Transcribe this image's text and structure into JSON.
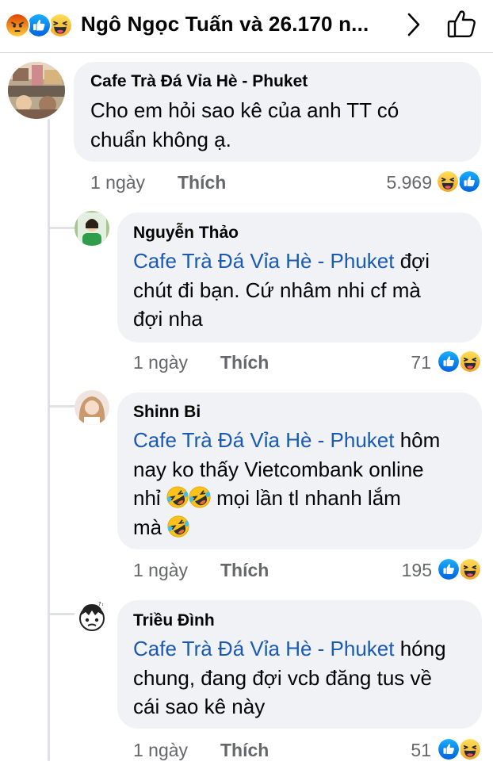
{
  "header": {
    "title": "Ngô Ngọc Tuấn và 26.170 n...",
    "reaction_icons": [
      "angry-icon",
      "like-icon",
      "haha-icon"
    ]
  },
  "comments": [
    {
      "author": "Cafe Trà Đá Vỉa Hè - Phuket",
      "text": "Cho em hỏi sao kê của anh TT có chuẩn không ạ.",
      "time": "1 ngày",
      "like": "Thích",
      "count": "5.969",
      "reactions": [
        "haha-icon",
        "like-icon"
      ]
    }
  ],
  "replies": [
    {
      "author": "Nguyễn Thảo",
      "mention": "Cafe Trà Đá Vỉa Hè - Phuket",
      "text_1": " đợi",
      "text_2": "chút đi bạn. Cứ nhâm nhi cf mà",
      "text_3": "đợi nha",
      "time": "1 ngày",
      "like": "Thích",
      "count": "71",
      "reactions": [
        "like-icon",
        "haha-icon"
      ]
    },
    {
      "author": "Shinn Bi",
      "mention": "Cafe Trà Đá Vỉa Hè - Phuket",
      "text_1": "  hôm",
      "text_2": "nay ko thấy Vietcombank online",
      "text_3a": "nhỉ ",
      "text_3b": " mọi lần tl nhanh lắm",
      "text_4": "mà ",
      "time": "1 ngày",
      "like": "Thích",
      "count": "195",
      "reactions": [
        "like-icon",
        "haha-icon"
      ]
    },
    {
      "author": "Triều Đình",
      "mention": "Cafe Trà Đá Vỉa Hè - Phuket",
      "text_1": " hóng",
      "text_2": "chung, đang đợi vcb đăng tus về",
      "text_3": "cái sao kê này",
      "time": "1 ngày",
      "like": "Thích",
      "count": "51",
      "reactions": [
        "like-icon",
        "haha-icon"
      ]
    }
  ],
  "colors": {
    "bubble": "#f0f2f5",
    "mention": "#1a5ab4",
    "meta": "#65676b",
    "like_blue": "#1877f2",
    "haha_yellow": "#f7b928",
    "angry_red": "#e9710f"
  }
}
